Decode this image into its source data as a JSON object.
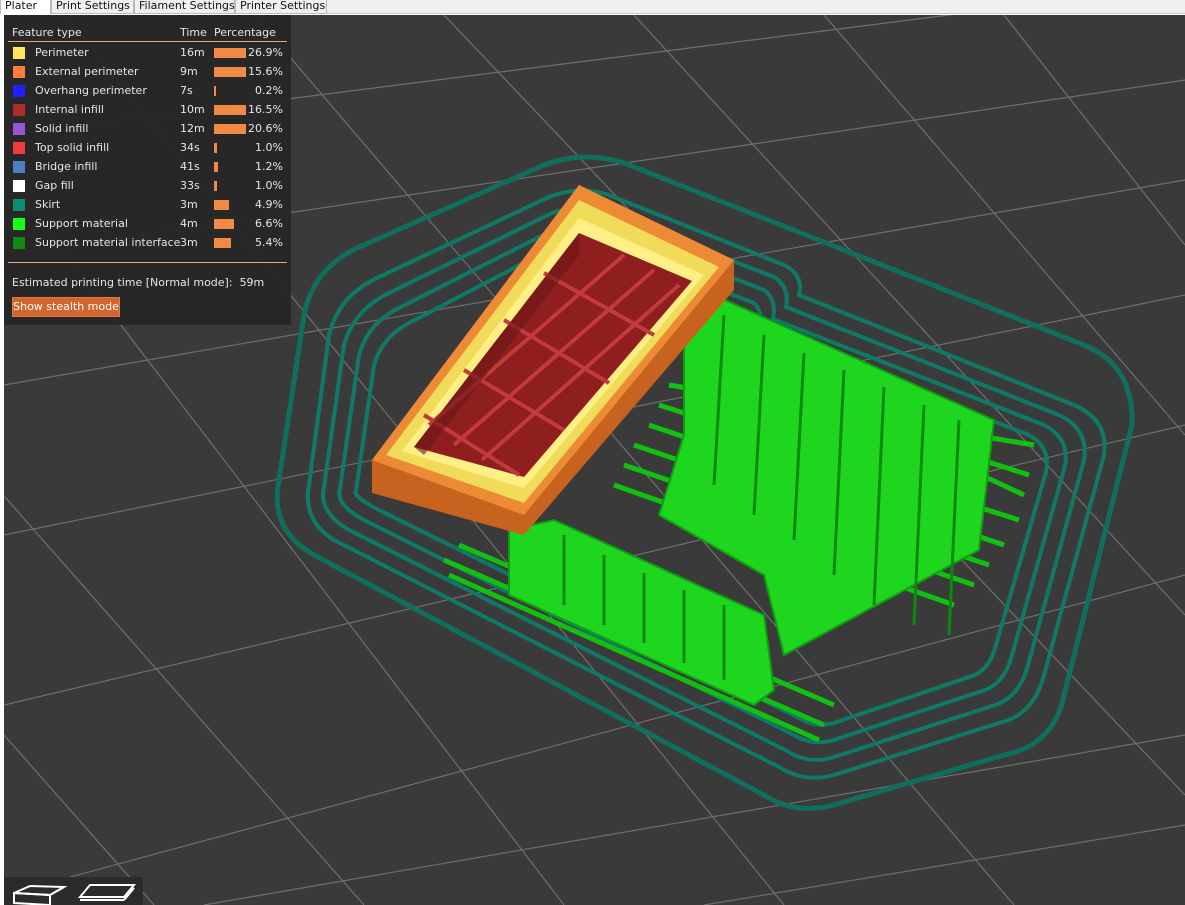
{
  "tabs": [
    {
      "label": "Plater",
      "active": true
    },
    {
      "label": "Print Settings",
      "active": false
    },
    {
      "label": "Filament Settings",
      "active": false
    },
    {
      "label": "Printer Settings",
      "active": false
    }
  ],
  "legend": {
    "headers": {
      "feature": "Feature type",
      "time": "Time",
      "percentage": "Percentage"
    },
    "rows": [
      {
        "name": "Perimeter",
        "time": "16m",
        "percent": "26.9%",
        "color": "#ffe65a",
        "fraction": 0.269
      },
      {
        "name": "External perimeter",
        "time": "9m",
        "percent": "15.6%",
        "color": "#ff7f3a",
        "fraction": 0.156
      },
      {
        "name": "Overhang perimeter",
        "time": "7s",
        "percent": "0.2%",
        "color": "#1f1fff",
        "fraction": 0.002
      },
      {
        "name": "Internal infill",
        "time": "10m",
        "percent": "16.5%",
        "color": "#b02a2a",
        "fraction": 0.165
      },
      {
        "name": "Solid infill",
        "time": "12m",
        "percent": "20.6%",
        "color": "#9a55d6",
        "fraction": 0.206
      },
      {
        "name": "Top solid infill",
        "time": "34s",
        "percent": "1.0%",
        "color": "#f03b3b",
        "fraction": 0.01
      },
      {
        "name": "Bridge infill",
        "time": "41s",
        "percent": "1.2%",
        "color": "#4f7fbf",
        "fraction": 0.012
      },
      {
        "name": "Gap fill",
        "time": "33s",
        "percent": "1.0%",
        "color": "#ffffff",
        "fraction": 0.01
      },
      {
        "name": "Skirt",
        "time": "3m",
        "percent": "4.9%",
        "color": "#0f8a73",
        "fraction": 0.049
      },
      {
        "name": "Support material",
        "time": "4m",
        "percent": "6.6%",
        "color": "#17ff17",
        "fraction": 0.066
      },
      {
        "name": "Support material interface",
        "time": "3m",
        "percent": "5.4%",
        "color": "#108a10",
        "fraction": 0.054
      }
    ],
    "estimate_label": "Estimated printing time [Normal mode]:",
    "estimate_value": "59m",
    "stealth_button": "Show stealth mode"
  },
  "view_buttons": [
    {
      "icon": "perspective-view-icon"
    },
    {
      "icon": "top-view-icon"
    }
  ]
}
